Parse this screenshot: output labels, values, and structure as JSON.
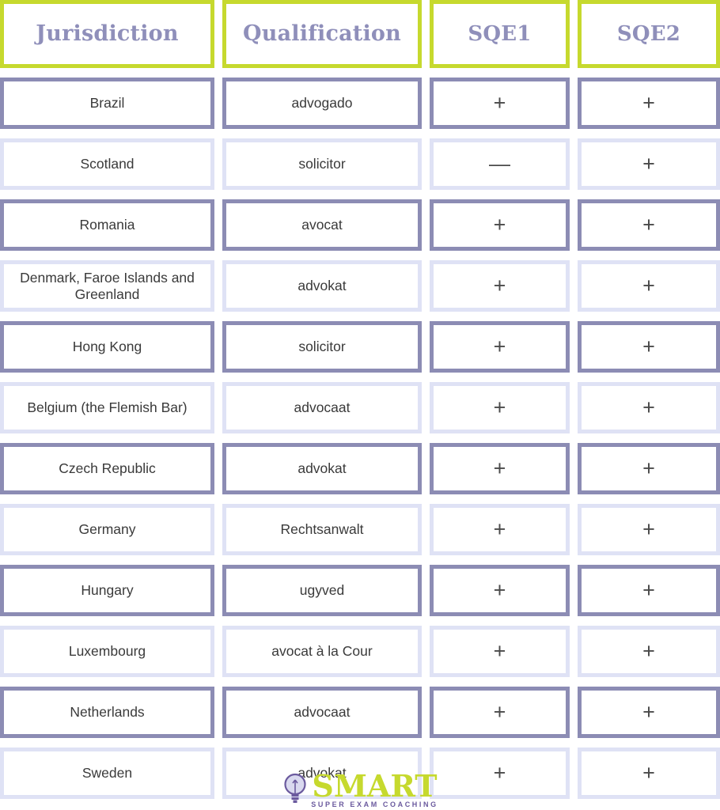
{
  "table": {
    "columns": [
      {
        "key": "jurisdiction",
        "label": "Jurisdiction"
      },
      {
        "key": "qualification",
        "label": "Qualification"
      },
      {
        "key": "sqe1",
        "label": "SQE1"
      },
      {
        "key": "sqe2",
        "label": "SQE2"
      }
    ],
    "marks": {
      "plus": "+",
      "minus": "—"
    },
    "rows": [
      {
        "jurisdiction": "Brazil",
        "qualification": "advogado",
        "sqe1": "+",
        "sqe2": "+",
        "style": "dark"
      },
      {
        "jurisdiction": "Scotland",
        "qualification": "solicitor",
        "sqe1": "—",
        "sqe2": "+",
        "style": "light"
      },
      {
        "jurisdiction": "Romania",
        "qualification": "avocat",
        "sqe1": "+",
        "sqe2": "+",
        "style": "dark"
      },
      {
        "jurisdiction": "Denmark, Faroe Islands and Greenland",
        "qualification": "advokat",
        "sqe1": "+",
        "sqe2": "+",
        "style": "light"
      },
      {
        "jurisdiction": "Hong Kong",
        "qualification": "solicitor",
        "sqe1": "+",
        "sqe2": "+",
        "style": "dark"
      },
      {
        "jurisdiction": "Belgium (the Flemish Bar)",
        "qualification": "advocaat",
        "sqe1": "+",
        "sqe2": "+",
        "style": "light"
      },
      {
        "jurisdiction": "Czech Republic",
        "qualification": "advokat",
        "sqe1": "+",
        "sqe2": "+",
        "style": "dark"
      },
      {
        "jurisdiction": "Germany",
        "qualification": "Rechtsanwalt",
        "sqe1": "+",
        "sqe2": "+",
        "style": "light"
      },
      {
        "jurisdiction": "Hungary",
        "qualification": "ugyved",
        "sqe1": "+",
        "sqe2": "+",
        "style": "dark"
      },
      {
        "jurisdiction": "Luxembourg",
        "qualification": "avocat à la Cour",
        "sqe1": "+",
        "sqe2": "+",
        "style": "light"
      },
      {
        "jurisdiction": "Netherlands",
        "qualification": "advocaat",
        "sqe1": "+",
        "sqe2": "+",
        "style": "dark"
      },
      {
        "jurisdiction": "Sweden",
        "qualification": "advokat",
        "sqe1": "+",
        "sqe2": "+",
        "style": "light"
      }
    ]
  },
  "logo": {
    "word": "SMART",
    "tagline": "SUPER EXAM COACHING",
    "icon": "lightbulb-icon"
  },
  "colors": {
    "header_border": "#c6d92e",
    "header_text": "#8f8fba",
    "row_border_dark": "#8c8cb4",
    "row_border_light": "#dfe2f5",
    "cell_text": "#3a3a3a",
    "logo_word": "#c6d92e",
    "logo_tagline": "#6b5a9e"
  }
}
